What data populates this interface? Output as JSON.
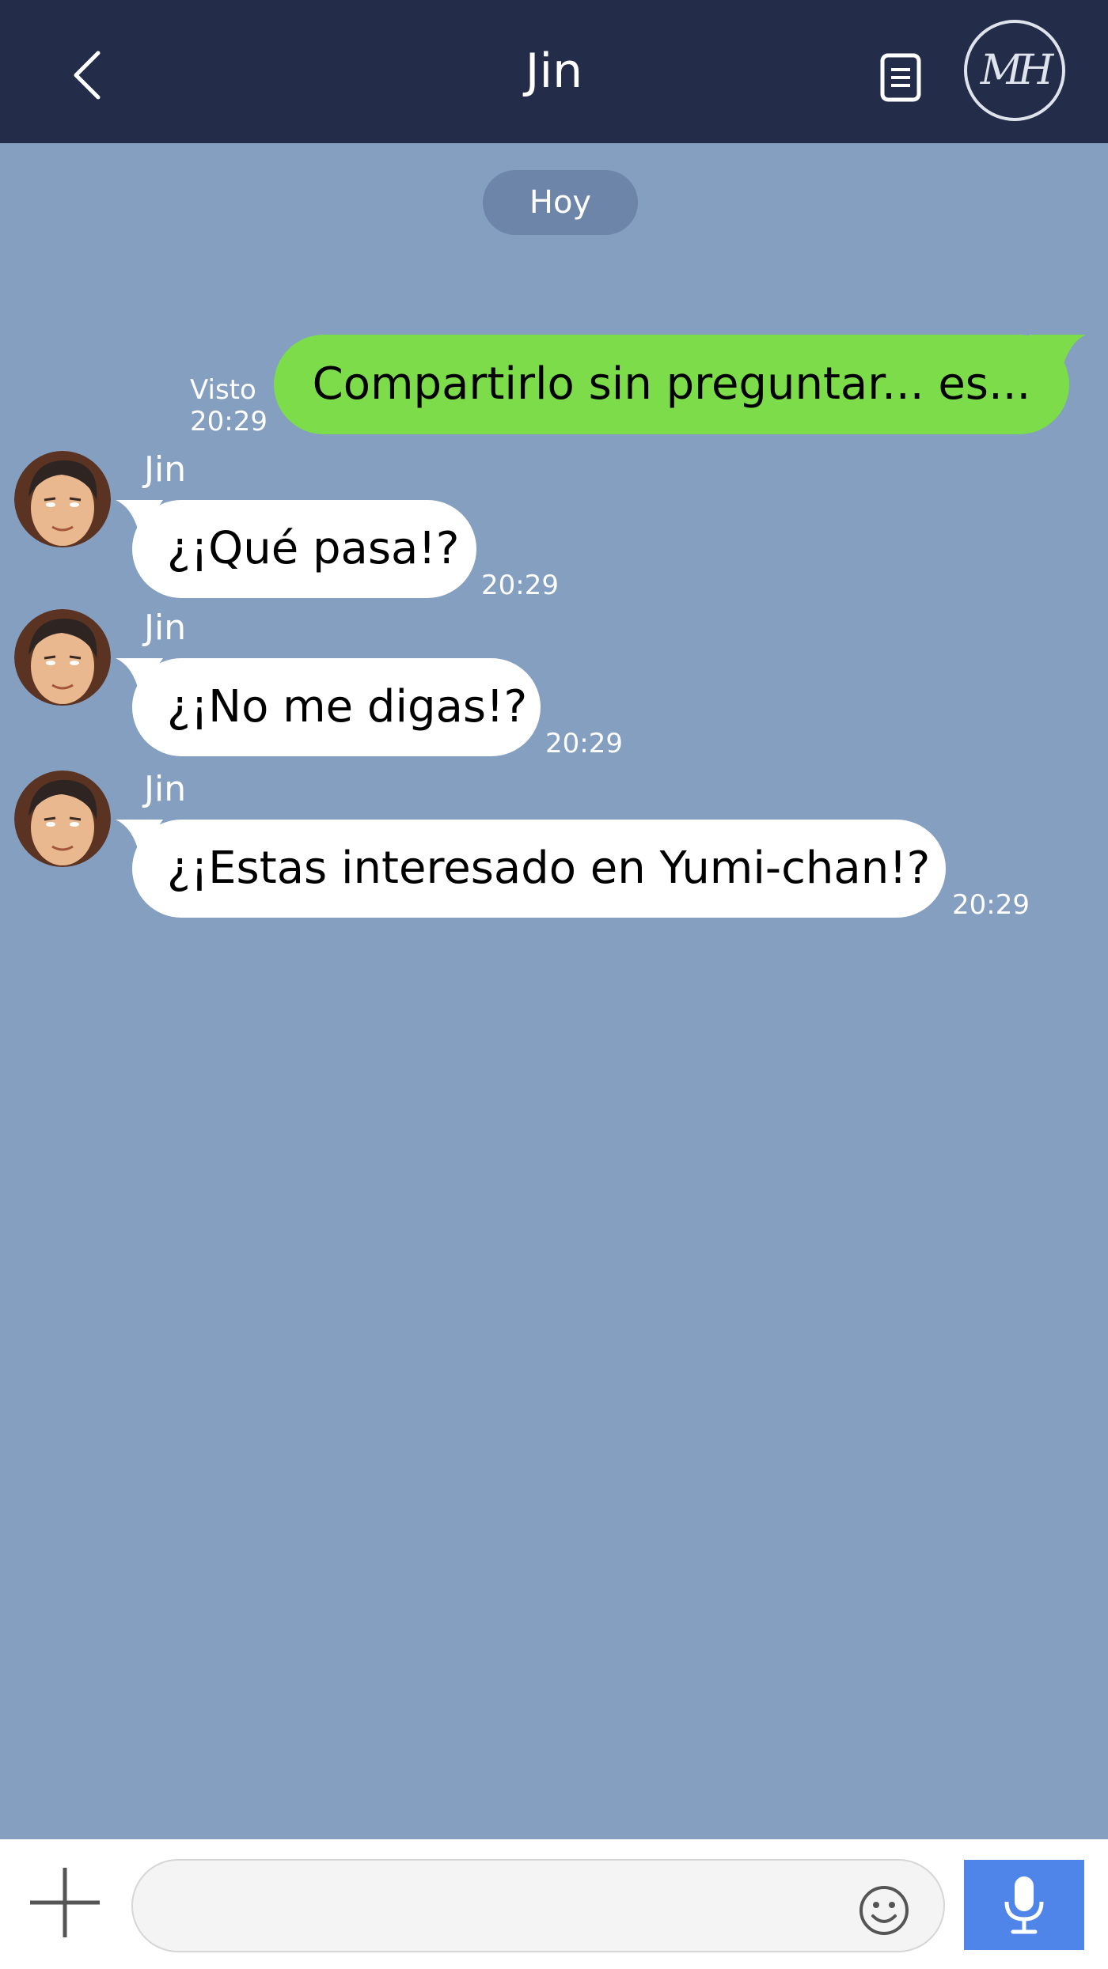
{
  "header": {
    "title": "Jin",
    "back_icon": "chevron-left-icon",
    "notes_icon": "document-icon",
    "logo_text": "MH"
  },
  "chat": {
    "date_label": "Hoy",
    "outgoing": {
      "text": "Compartirlo sin preguntar... es...",
      "status": "Visto",
      "time": "20:29"
    },
    "incoming": [
      {
        "sender": "Jin",
        "text": "¿¡Qué pasa!?",
        "time": "20:29"
      },
      {
        "sender": "Jin",
        "text": "¿¡No me digas!?",
        "time": "20:29"
      },
      {
        "sender": "Jin",
        "text": "¿¡Estas interesado en Yumi-chan!?",
        "time": "20:29"
      }
    ]
  },
  "composer": {
    "plus_icon": "plus-icon",
    "input_value": "",
    "emoji_icon": "smiley-icon",
    "mic_icon": "microphone-icon"
  },
  "colors": {
    "header_bg": "#232c49",
    "chat_bg": "#849fc0",
    "outgoing_bubble": "#7ddc4a",
    "incoming_bubble": "#ffffff",
    "mic_button": "#4f84e8"
  }
}
